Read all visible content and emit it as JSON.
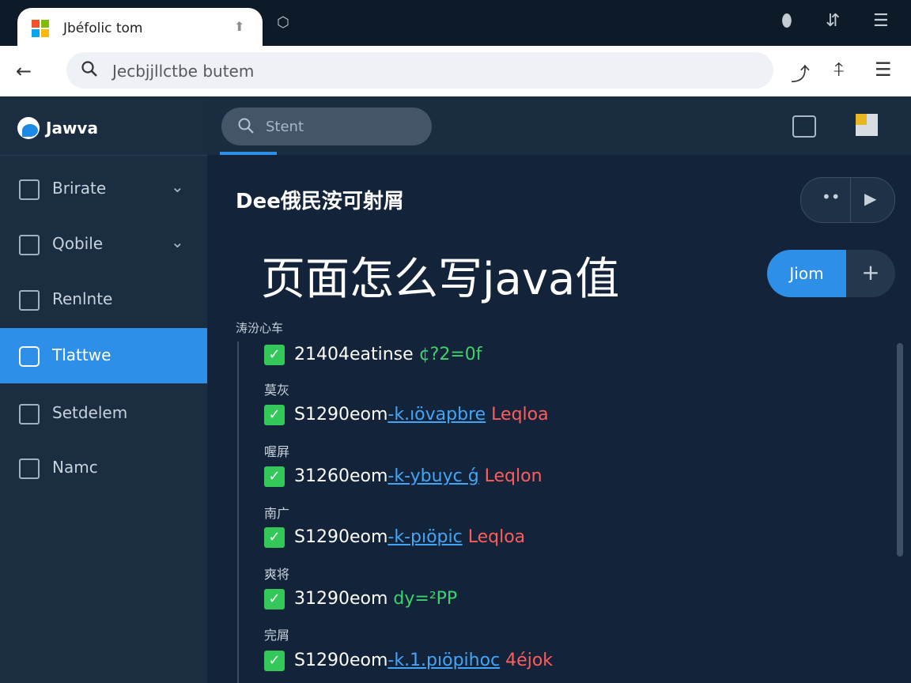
{
  "browser": {
    "tab_title": "Jbéfolic tom",
    "address_text": "Jecbjjllctbe butem"
  },
  "app": {
    "brand": "Jawva",
    "sidebar": {
      "items": [
        {
          "label": "Brirate",
          "has_chevron": true
        },
        {
          "label": "Qobile",
          "has_chevron": true
        },
        {
          "label": "Renlnte",
          "has_chevron": false
        },
        {
          "label": "Tlattwe",
          "active": true
        },
        {
          "label": "Setdelem",
          "has_chevron": false
        },
        {
          "label": "Namc",
          "has_chevron": false
        }
      ]
    },
    "search": {
      "placeholder": "Stent"
    },
    "main": {
      "section_title": "Dee俄民洝可射屑",
      "heading": "页面怎么写java值",
      "primary_button": "Jiom",
      "plus_button": "+",
      "list_label": "涛汾心车",
      "rows": [
        {
          "label": "",
          "text": "21404eatinse",
          "tail": "¢?2=0f",
          "tail_color": "green",
          "link": ""
        },
        {
          "label": "莫灰",
          "text": "S1290eom",
          "link": "-k.ıövapbre",
          "tail": "Leqloa",
          "tail_color": "red"
        },
        {
          "label": "喔屛",
          "text": "31260eom",
          "link": "-k-ybuyc ǵ",
          "tail": "Leqlon",
          "tail_color": "red"
        },
        {
          "label": "南广",
          "text": "S1290eom",
          "link": "-k-pıöpic",
          "tail": "Leqloa",
          "tail_color": "red"
        },
        {
          "label": "爽将",
          "text": "31290eom",
          "link": "",
          "tail": "dy=²PP",
          "tail_color": "green"
        },
        {
          "label": "完屑",
          "text": "S1290eom",
          "link": "-k.1.pıöpihoc",
          "tail": "4éjok",
          "tail_color": "red"
        }
      ]
    }
  },
  "colors": {
    "accent": "#2e8fe8",
    "check": "#34c759",
    "sidebar_bg": "#1b2d40",
    "main_bg": "#13243a"
  }
}
